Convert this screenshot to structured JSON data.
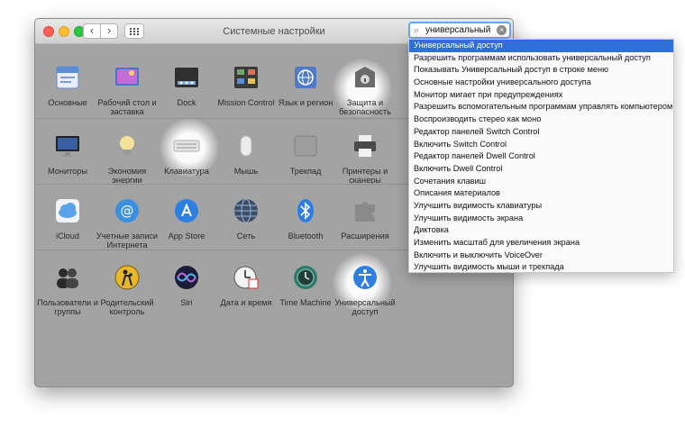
{
  "window": {
    "title": "Системные настройки"
  },
  "search": {
    "value": "универсальный",
    "clear_icon": "clear-icon"
  },
  "rows": [
    {
      "items": [
        {
          "label": "Основные",
          "icon": "general-icon",
          "color": "#5b8dd6"
        },
        {
          "label": "Рабочий стол и заставка",
          "icon": "desktop-icon",
          "color": "#4a74c9"
        },
        {
          "label": "Dock",
          "icon": "dock-icon",
          "color": "#2f2f2f"
        },
        {
          "label": "Mission Control",
          "icon": "mission-control-icon",
          "color": "#3a3a3a"
        },
        {
          "label": "Язык и регион",
          "icon": "language-icon",
          "color": "#4e7ac8"
        },
        {
          "label": "Защита и безопасность",
          "icon": "security-icon",
          "color": "#6a6a6a"
        }
      ]
    },
    {
      "items": [
        {
          "label": "Мониторы",
          "icon": "displays-icon",
          "color": "#3a5fa0"
        },
        {
          "label": "Экономия энергии",
          "icon": "energy-icon",
          "color": "#e2c36a"
        },
        {
          "label": "Клавиатура",
          "icon": "keyboard-icon",
          "color": "#dcdcdc"
        },
        {
          "label": "Мышь",
          "icon": "mouse-icon",
          "color": "#d8d8d8"
        },
        {
          "label": "Трекпад",
          "icon": "trackpad-icon",
          "color": "#9e9e9e"
        },
        {
          "label": "Принтеры и сканеры",
          "icon": "printer-icon",
          "color": "#4a4a4a"
        }
      ]
    },
    {
      "items": [
        {
          "label": "iCloud",
          "icon": "icloud-icon",
          "color": "#5ba3e8"
        },
        {
          "label": "Учетные записи Интернета",
          "icon": "internet-accounts-icon",
          "color": "#3b8fe0"
        },
        {
          "label": "App Store",
          "icon": "app-store-icon",
          "color": "#2d7fe0"
        },
        {
          "label": "Сеть",
          "icon": "network-icon",
          "color": "#3c4f6a"
        },
        {
          "label": "Bluetooth",
          "icon": "bluetooth-icon",
          "color": "#2f7de0"
        },
        {
          "label": "Расширения",
          "icon": "extensions-icon",
          "color": "#8a8a8a"
        }
      ]
    },
    {
      "items": [
        {
          "label": "Пользователи и группы",
          "icon": "users-icon",
          "color": "#2a2a2a"
        },
        {
          "label": "Родительский контроль",
          "icon": "parental-controls-icon",
          "color": "#e8b82a"
        },
        {
          "label": "Siri",
          "icon": "siri-icon",
          "color": "#6a4bd0"
        },
        {
          "label": "Дата и время",
          "icon": "date-time-icon",
          "color": "#e8e8e8"
        },
        {
          "label": "Time Machine",
          "icon": "time-machine-icon",
          "color": "#2f7a6e"
        },
        {
          "label": "Универсальный доступ",
          "icon": "accessibility-icon",
          "color": "#2f7fe0"
        }
      ]
    }
  ],
  "suggestions": [
    "Универсальный доступ",
    "Разрешить программам использовать универсальный доступ",
    "Показывать Универсальный доступ в строке меню",
    "Основные настройки универсального доступа",
    "Монитор мигает при предупреждениях",
    "Разрешить вспомогательным программам управлять компьютером",
    "Воспроизводить стерео как моно",
    "Редактор панелей Switch Control",
    "Включить Switch Control",
    "Редактор панелей Dwell Control",
    "Включить Dwell Control",
    "Сочетания клавиш",
    "Описания материалов",
    "Улучшить видимость клавиатуры",
    "Улучшить видимость экрана",
    "Диктовка",
    "Изменить масштаб для увеличения экрана",
    "Включить и выключить VoiceOver",
    "Улучшить видимость мыши и трекпада"
  ],
  "selected_suggestion": 0
}
